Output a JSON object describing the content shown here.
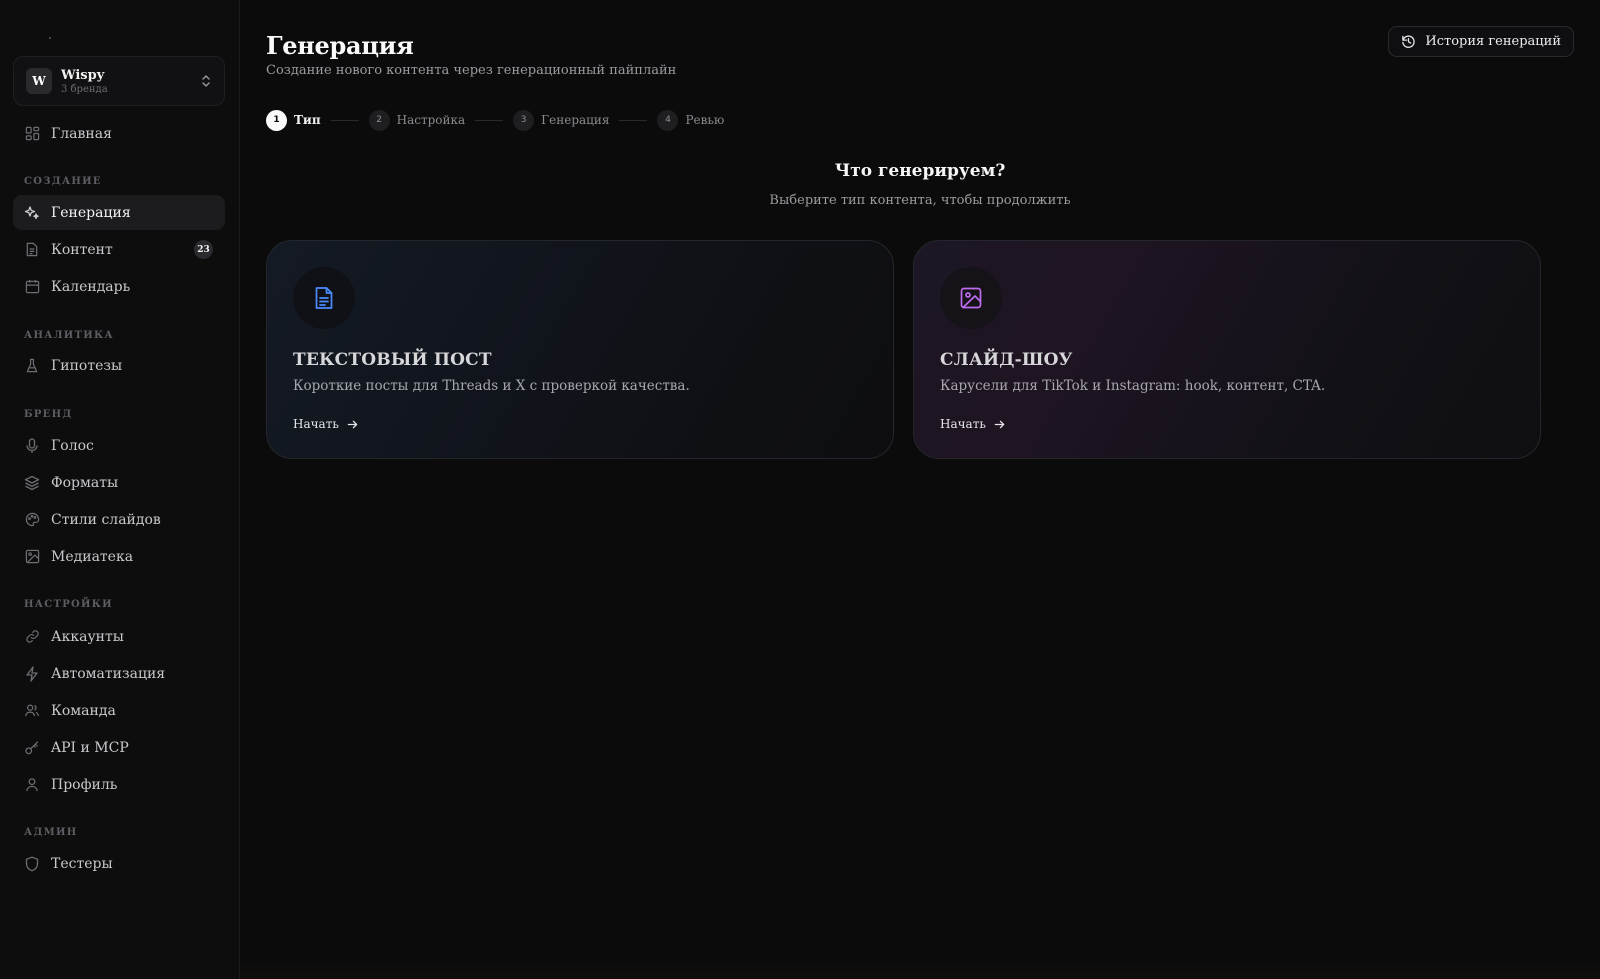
{
  "brand": {
    "initial": "W",
    "name": "Wispy",
    "subtitle": "3 бренда"
  },
  "sidebar": {
    "home": "Главная",
    "sections": {
      "create": "СОЗДАНИЕ",
      "analytics": "АНАЛИТИКА",
      "brand": "БРЕНД",
      "settings": "НАСТРОЙКИ",
      "admin": "АДМИН"
    },
    "items": {
      "generation": "Генерация",
      "content": "Контент",
      "content_badge": "23",
      "calendar": "Календарь",
      "hypotheses": "Гипотезы",
      "voice": "Голос",
      "formats": "Форматы",
      "slide_styles": "Стили слайдов",
      "media": "Медиатека",
      "accounts": "Аккаунты",
      "automation": "Автоматизация",
      "team": "Команда",
      "api": "API и MCP",
      "profile": "Профиль",
      "testers": "Тестеры"
    }
  },
  "header": {
    "title": "Генерация",
    "subtitle": "Создание нового контента через генерационный пайплайн",
    "history_button": "История генераций"
  },
  "stepper": [
    {
      "num": "1",
      "label": "Тип",
      "active": true
    },
    {
      "num": "2",
      "label": "Настройка",
      "active": false
    },
    {
      "num": "3",
      "label": "Генерация",
      "active": false
    },
    {
      "num": "4",
      "label": "Ревью",
      "active": false
    }
  ],
  "main": {
    "question": "Что генерируем?",
    "question_sub": "Выберите тип контента, чтобы продолжить",
    "cards": [
      {
        "title": "ТЕКСТОВЫЙ ПОСТ",
        "description": "Короткие посты для Threads и X с проверкой качества.",
        "cta": "Начать",
        "icon": "file-text-icon",
        "icon_color": "#4a8cff"
      },
      {
        "title": "СЛАЙД-ШОУ",
        "description": "Карусели для TikTok и Instagram: hook, контент, CTA.",
        "cta": "Начать",
        "icon": "image-icon",
        "icon_color": "#c06cf0"
      }
    ]
  },
  "colors": {
    "background": "#0b0b0c",
    "sidebar": "#0d0d0e",
    "active_item": "#1c1c1f"
  }
}
